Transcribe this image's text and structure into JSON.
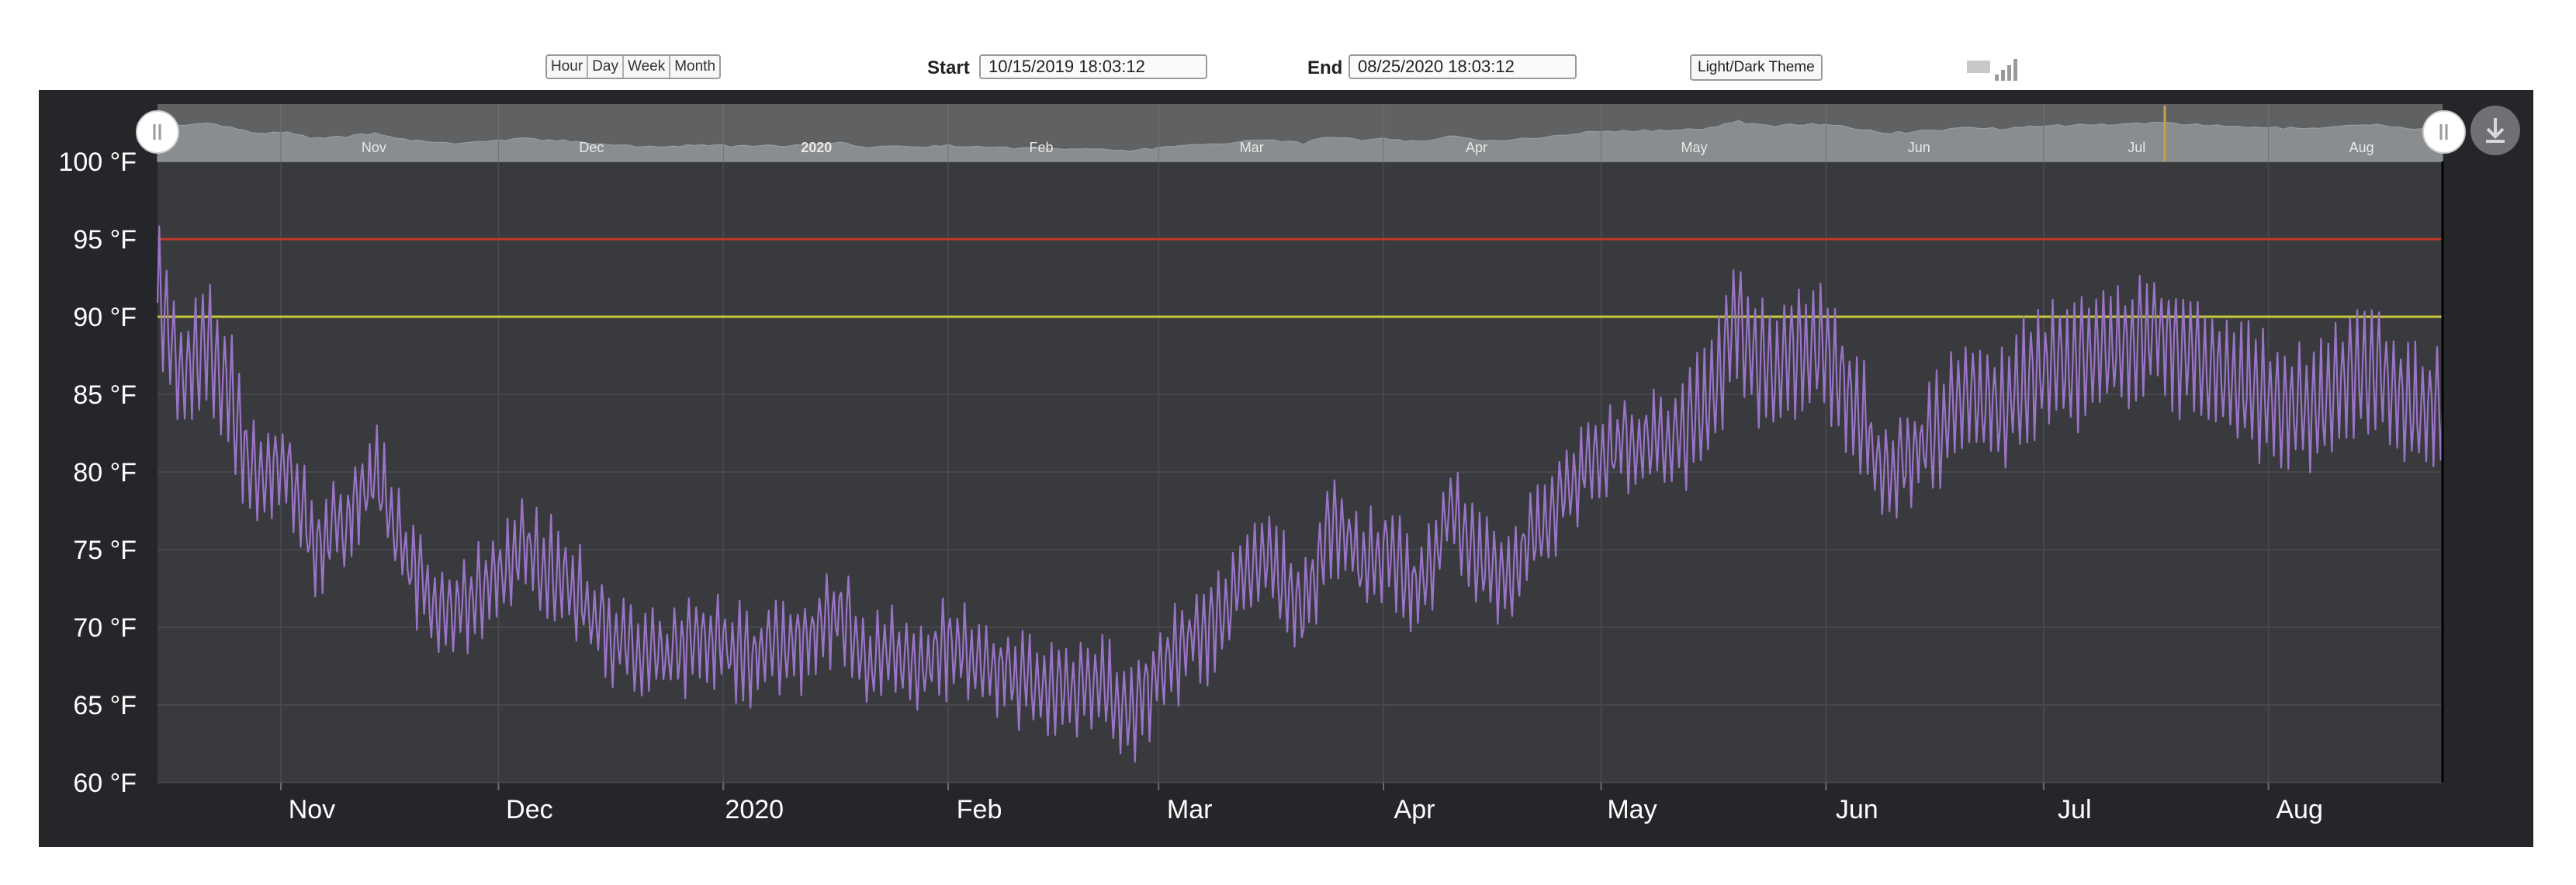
{
  "toolbar": {
    "range_buttons": [
      "Hour",
      "Day",
      "Week",
      "Month"
    ],
    "start_label": "Start",
    "start_value": "10/15/2019 18:03:12",
    "end_label": "End",
    "end_value": "08/25/2020 18:03:12",
    "theme_button": "Light/Dark Theme",
    "signal_icon": "signal-strength-icon"
  },
  "navigator": {
    "months": [
      "Nov",
      "Dec",
      "2020",
      "Feb",
      "Mar",
      "Apr",
      "May",
      "Jun",
      "Jul",
      "Aug"
    ],
    "left_handle_icon": "pause-handle-icon",
    "right_handle_icon": "pause-handle-icon",
    "download_icon": "download-icon"
  },
  "colors": {
    "background": "#242629",
    "plot": "#393a3d",
    "series": "#9b74c8",
    "upper_threshold": "#c0392b",
    "lower_threshold": "#c8c83a",
    "navigator_fill": "#8a8d8f"
  },
  "chart_data": {
    "type": "line",
    "x_range": [
      "2019-10-15",
      "2020-08-25"
    ],
    "x_ticks": [
      "Nov",
      "Dec",
      "2020",
      "Feb",
      "Mar",
      "Apr",
      "May",
      "Jun",
      "Jul",
      "Aug"
    ],
    "y_ticks": [
      "60 °F",
      "65 °F",
      "70 °F",
      "75 °F",
      "80 °F",
      "85 °F",
      "90 °F",
      "95 °F",
      "100 °F"
    ],
    "ylim": [
      60,
      100
    ],
    "y_unit": "°F",
    "grid": true,
    "thresholds": [
      {
        "value": 95,
        "color": "#c0392b"
      },
      {
        "value": 90,
        "color": "#c8c83a"
      }
    ],
    "series": [
      {
        "color": "#9b74c8",
        "points": [
          [
            "2019-10-15",
            92
          ],
          [
            "2019-10-18",
            86
          ],
          [
            "2019-10-22",
            88
          ],
          [
            "2019-10-25",
            85
          ],
          [
            "2019-10-28",
            80
          ],
          [
            "2019-11-02",
            80
          ],
          [
            "2019-11-06",
            75
          ],
          [
            "2019-11-10",
            77
          ],
          [
            "2019-11-14",
            80
          ],
          [
            "2019-11-18",
            75
          ],
          [
            "2019-11-22",
            71
          ],
          [
            "2019-11-26",
            71
          ],
          [
            "2019-11-30",
            73
          ],
          [
            "2019-12-04",
            75
          ],
          [
            "2019-12-08",
            74
          ],
          [
            "2019-12-12",
            72
          ],
          [
            "2019-12-16",
            70
          ],
          [
            "2019-12-20",
            68
          ],
          [
            "2019-12-24",
            68
          ],
          [
            "2019-12-28",
            69
          ],
          [
            "2020-01-01",
            69
          ],
          [
            "2020-01-05",
            68
          ],
          [
            "2020-01-09",
            69
          ],
          [
            "2020-01-13",
            69
          ],
          [
            "2020-01-17",
            71
          ],
          [
            "2020-01-21",
            68
          ],
          [
            "2020-01-25",
            68
          ],
          [
            "2020-01-29",
            68
          ],
          [
            "2020-02-02",
            69
          ],
          [
            "2020-02-06",
            67
          ],
          [
            "2020-02-10",
            67
          ],
          [
            "2020-02-14",
            66
          ],
          [
            "2020-02-18",
            66
          ],
          [
            "2020-02-22",
            67
          ],
          [
            "2020-02-26",
            64
          ],
          [
            "2020-03-01",
            67
          ],
          [
            "2020-03-05",
            69
          ],
          [
            "2020-03-09",
            70
          ],
          [
            "2020-03-13",
            74
          ],
          [
            "2020-03-17",
            74
          ],
          [
            "2020-03-21",
            71
          ],
          [
            "2020-03-25",
            77
          ],
          [
            "2020-03-29",
            74
          ],
          [
            "2020-04-02",
            75
          ],
          [
            "2020-04-06",
            72
          ],
          [
            "2020-04-10",
            78
          ],
          [
            "2020-04-14",
            74
          ],
          [
            "2020-04-18",
            73
          ],
          [
            "2020-04-22",
            76
          ],
          [
            "2020-04-26",
            79
          ],
          [
            "2020-04-30",
            81
          ],
          [
            "2020-05-04",
            82
          ],
          [
            "2020-05-08",
            82
          ],
          [
            "2020-05-12",
            82
          ],
          [
            "2020-05-16",
            85
          ],
          [
            "2020-05-20",
            90
          ],
          [
            "2020-05-24",
            86
          ],
          [
            "2020-05-28",
            88
          ],
          [
            "2020-06-01",
            88
          ],
          [
            "2020-06-05",
            84
          ],
          [
            "2020-06-09",
            80
          ],
          [
            "2020-06-13",
            81
          ],
          [
            "2020-06-17",
            83
          ],
          [
            "2020-06-21",
            85
          ],
          [
            "2020-06-25",
            84
          ],
          [
            "2020-06-29",
            86
          ],
          [
            "2020-07-03",
            87
          ],
          [
            "2020-07-07",
            87
          ],
          [
            "2020-07-11",
            88
          ],
          [
            "2020-07-15",
            89
          ],
          [
            "2020-07-19",
            88
          ],
          [
            "2020-07-23",
            87
          ],
          [
            "2020-07-27",
            86
          ],
          [
            "2020-07-31",
            85
          ],
          [
            "2020-08-04",
            84
          ],
          [
            "2020-08-08",
            84
          ],
          [
            "2020-08-12",
            86
          ],
          [
            "2020-08-16",
            87
          ],
          [
            "2020-08-20",
            84
          ],
          [
            "2020-08-25",
            84
          ]
        ]
      }
    ]
  }
}
